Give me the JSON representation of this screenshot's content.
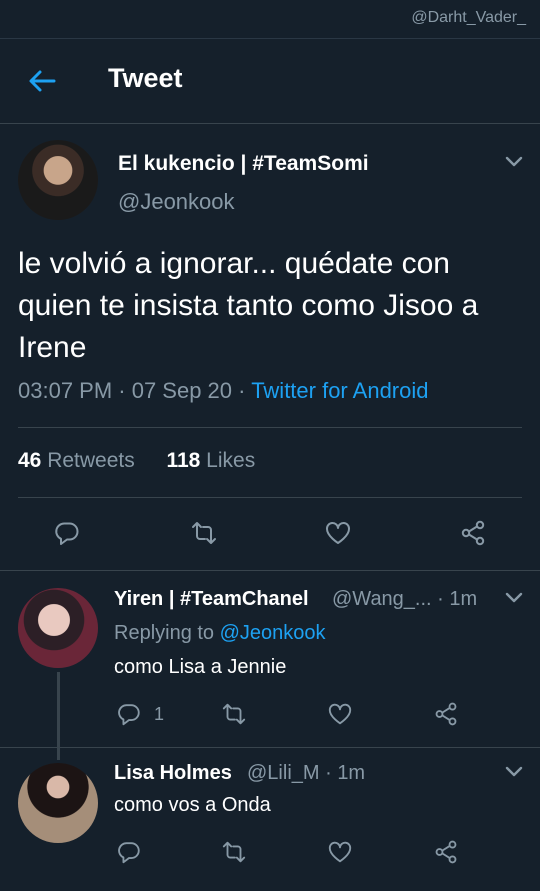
{
  "watermark": "@Darht_Vader_",
  "header": {
    "title": "Tweet"
  },
  "tweet": {
    "author_name": "El kukencio | #TeamSomi",
    "author_handle": "@Jeonkook",
    "text": "le volvió a ignorar... quédate con quien te insista tanto como Jisoo a Irene",
    "time": "03:07 PM · 07 Sep 20 · ",
    "source": "Twitter for Android",
    "retweets_count": "46",
    "retweets_label": "Retweets",
    "likes_count": "118",
    "likes_label": "Likes"
  },
  "replies": [
    {
      "name": "Yiren | #TeamChanel",
      "handle": "@Wang_... · 1m",
      "replying_prefix": "Replying to ",
      "replying_to": "@Jeonkook",
      "text": "como Lisa a Jennie",
      "reply_count": "1"
    },
    {
      "name": "Lisa Holmes",
      "handle": "@Lili_M · 1m",
      "text": "como vos a Onda"
    }
  ],
  "icons": [
    "back-arrow-icon",
    "chevron-down-icon",
    "reply-icon",
    "retweet-icon",
    "like-icon",
    "share-icon"
  ],
  "colors": {
    "background": "#15202b",
    "accent": "#1da1f2",
    "muted": "#8899a6",
    "divider": "#38444d"
  }
}
